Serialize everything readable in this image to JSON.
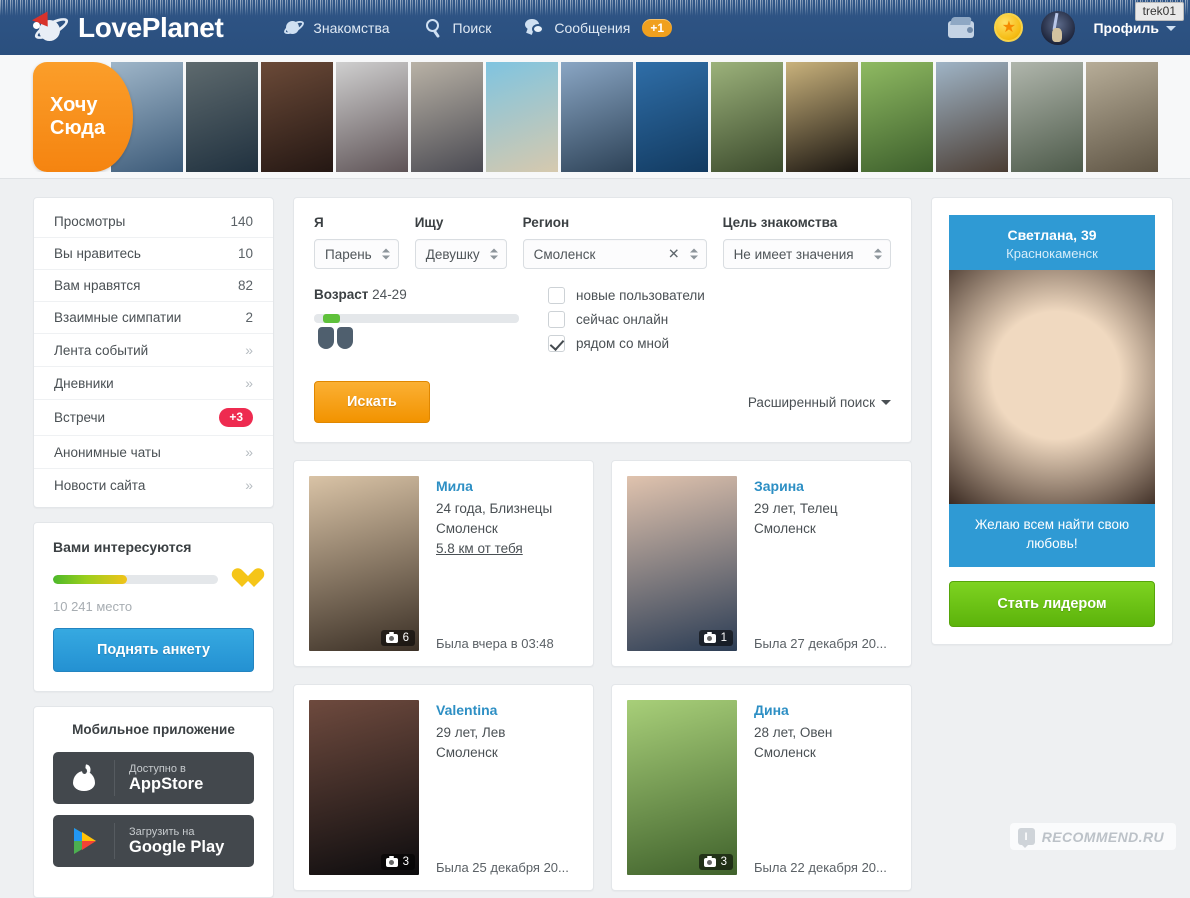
{
  "header": {
    "brand": "LovePlanet",
    "logo_icon": "planet-santa-hat-icon",
    "nav": [
      {
        "label": "Знакомства",
        "icon": "planet-icon"
      },
      {
        "label": "Поиск",
        "icon": "search-icon"
      },
      {
        "label": "Сообщения",
        "icon": "message-icon",
        "badge": "+1"
      }
    ],
    "wallet_icon": "wallet-icon",
    "coin_icon": "star-coin-icon",
    "avatar_icon": "user-avatar",
    "profile_label": "Профиль",
    "username_tooltip": "trek01"
  },
  "strip": {
    "cta_line1": "Хочу",
    "cta_line2": "Сюда",
    "tiles": [
      {
        "name": "strip-photo-1",
        "c1": "#9fb6c9",
        "c2": "#3c5a78"
      },
      {
        "name": "strip-photo-2",
        "c1": "#5e6a6e",
        "c2": "#20313f"
      },
      {
        "name": "strip-photo-3",
        "c1": "#6b4a38",
        "c2": "#241713"
      },
      {
        "name": "strip-photo-4",
        "c1": "#cfcfcf",
        "c2": "#5e5356"
      },
      {
        "name": "strip-photo-5",
        "c1": "#b9b2a6",
        "c2": "#4a4a52"
      },
      {
        "name": "strip-photo-6",
        "c1": "#7fc4e0",
        "c2": "#d6c9ae"
      },
      {
        "name": "strip-photo-7",
        "c1": "#8aa6c4",
        "c2": "#2d4257"
      },
      {
        "name": "strip-photo-8",
        "c1": "#2f6ea8",
        "c2": "#123a60"
      },
      {
        "name": "strip-photo-9",
        "c1": "#9cb27b",
        "c2": "#3b4a2c"
      },
      {
        "name": "strip-photo-10",
        "c1": "#c9b27c",
        "c2": "#1a1510"
      },
      {
        "name": "strip-photo-11",
        "c1": "#8fba62",
        "c2": "#3d5f2c"
      },
      {
        "name": "strip-photo-12",
        "c1": "#9fb4c6",
        "c2": "#4b3d33"
      },
      {
        "name": "strip-photo-13",
        "c1": "#b0b6ac",
        "c2": "#4d5a4a"
      },
      {
        "name": "strip-photo-14",
        "c1": "#b7ad98",
        "c2": "#5e5444"
      }
    ]
  },
  "sidebar": {
    "stats": [
      {
        "label": "Просмотры",
        "value": "140",
        "type": "num"
      },
      {
        "label": "Вы нравитесь",
        "value": "10",
        "type": "num"
      },
      {
        "label": "Вам нравятся",
        "value": "82",
        "type": "num"
      },
      {
        "label": "Взаимные симпатии",
        "value": "2",
        "type": "num"
      },
      {
        "label": "Лента событий",
        "value": "»",
        "type": "chev"
      },
      {
        "label": "Дневники",
        "value": "»",
        "type": "chev"
      },
      {
        "label": "Встречи",
        "value": "+3",
        "type": "pill"
      },
      {
        "label": "Анонимные чаты",
        "value": "»",
        "type": "chev"
      },
      {
        "label": "Новости сайта",
        "value": "»",
        "type": "chev"
      }
    ],
    "interest": {
      "title": "Вами интересуются",
      "progress_percent": 45,
      "heart_icon": "heart-icon",
      "place": "10 241 место",
      "raise_button": "Поднять анкету"
    },
    "mobile": {
      "title": "Мобильное приложение",
      "appstore_small": "Доступно в",
      "appstore_big": "AppStore",
      "appstore_icon": "apple-icon",
      "gplay_small": "Загрузить на",
      "gplay_big": "Google Play",
      "gplay_icon": "google-play-icon"
    }
  },
  "search": {
    "me_label": "Я",
    "me_value": "Парень",
    "seek_label": "Ищу",
    "seek_value": "Девушку",
    "region_label": "Регион",
    "region_value": "Смоленск",
    "goal_label": "Цель знакомства",
    "goal_value": "Не имеет значения",
    "age_label": "Возраст",
    "age_value": "24-29",
    "checkboxes": [
      {
        "label": "новые пользователи",
        "checked": false
      },
      {
        "label": "сейчас онлайн",
        "checked": false
      },
      {
        "label": "рядом со мной",
        "checked": true
      }
    ],
    "submit_label": "Искать",
    "advanced_label": "Расширенный поиск"
  },
  "results": [
    {
      "name": "Мила",
      "age_sign": "24 года, Близнецы",
      "city": "Смоленск",
      "distance": "5.8 км от тебя",
      "photo_count": "6",
      "last_seen": "Была вчера в 03:48",
      "photo_c1": "#d9c3a6",
      "photo_c2": "#3b3026"
    },
    {
      "name": "Зарина",
      "age_sign": "29 лет, Телец",
      "city": "Смоленск",
      "distance": "",
      "photo_count": "1",
      "last_seen": "Была 27 декабря 20...",
      "photo_c1": "#e0c3ae",
      "photo_c2": "#2c3d55"
    },
    {
      "name": "Valentina",
      "age_sign": "29 лет, Лев",
      "city": "Смоленск",
      "distance": "",
      "photo_count": "3",
      "last_seen": "Была 25 декабря 20...",
      "photo_c1": "#6e4a3e",
      "photo_c2": "#0d0c0e"
    },
    {
      "name": "Дина",
      "age_sign": "28 лет, Овен",
      "city": "Смоленск",
      "distance": "",
      "photo_count": "3",
      "last_seen": "Была 22 декабря 20...",
      "photo_c1": "#a8cf79",
      "photo_c2": "#40622c"
    }
  ],
  "leader": {
    "name": "Светлана, 39",
    "city": "Краснокаменск",
    "quote": "Желаю всем найти свою любовь!",
    "cta": "Стать лидером",
    "photo_c1": "#f0d9c0",
    "photo_c2": "#3a2a22"
  },
  "watermark": {
    "badge": "I",
    "text": "RECOMMEND.RU"
  },
  "colors": {
    "header_blue": "#2e5584",
    "accent_orange": "#f29300",
    "link_blue": "#2d8fc4",
    "leader_blue": "#2f9ad4",
    "green": "#5cb30b",
    "red_pill": "#ee2b50"
  }
}
